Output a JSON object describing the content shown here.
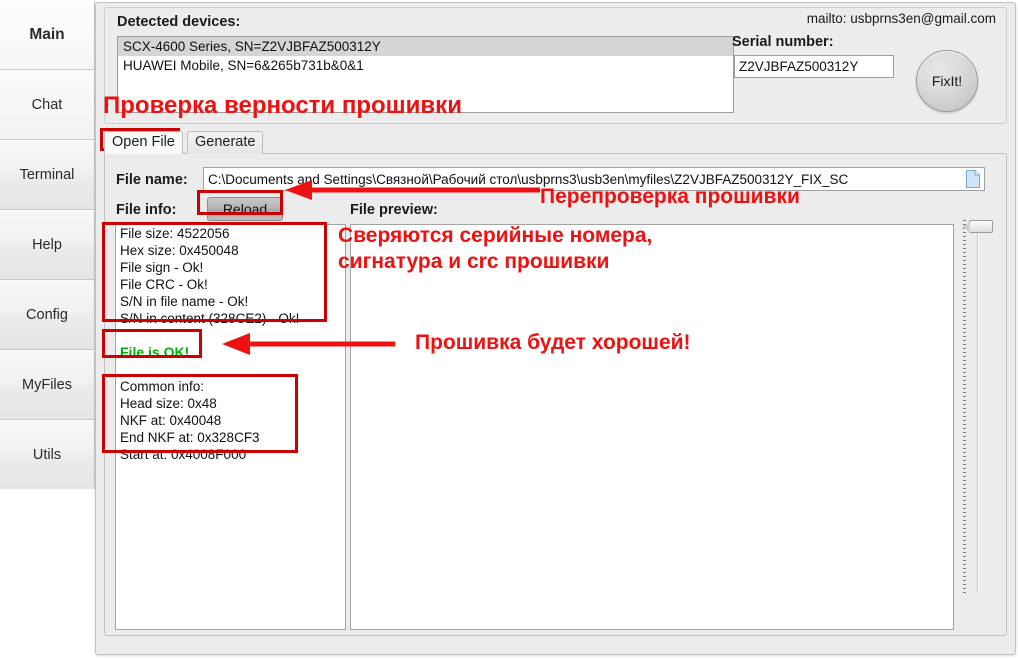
{
  "sidebar": {
    "items": [
      {
        "label": "Main",
        "selected": true
      },
      {
        "label": "Chat",
        "selected": false
      },
      {
        "label": "Terminal",
        "selected": false
      },
      {
        "label": "Help",
        "selected": false
      },
      {
        "label": "Config",
        "selected": false
      },
      {
        "label": "MyFiles",
        "selected": false
      },
      {
        "label": "Utils",
        "selected": false
      }
    ]
  },
  "device_group": {
    "detected_label": "Detected devices:",
    "devices": [
      {
        "text": "SCX-4600 Series, SN=Z2VJBFAZ500312Y",
        "selected": true
      },
      {
        "text": "HUAWEI Mobile, SN=6&265b731b&0&1",
        "selected": false
      }
    ],
    "mailto": "mailto: usbprns3en@gmail.com",
    "serial_label": "Serial number:",
    "serial_value": "Z2VJBFAZ500312Y",
    "fixit_label": "FixIt!"
  },
  "tabs": [
    {
      "label": "Open File",
      "selected": true
    },
    {
      "label": "Generate",
      "selected": false
    }
  ],
  "form": {
    "filename_label": "File name:",
    "filename_value": "C:\\Documents and Settings\\Связной\\Рабочий стол\\usbprns3\\usb3en\\myfiles\\Z2VJBFAZ500312Y_FIX_SC",
    "fileinfo_label": "File info:",
    "reload_label": "Reload",
    "preview_label": "File preview:"
  },
  "file_info": {
    "lines": [
      "File size: 4522056",
      "Hex size: 0x450048",
      "File sign - Ok!",
      "File CRC - Ok!",
      "S/N in file name - Ok!",
      "S/N in content (328CE2) - Ok!"
    ],
    "status": "File is OK!",
    "common": [
      "Common info:",
      "Head size: 0x48",
      "NKF at: 0x40048",
      "End NKF at: 0x328CF3",
      "Start at: 0x4008F000"
    ]
  },
  "annotations": {
    "title": "Проверка верности прошивки",
    "recheck": "Перепроверка прошивки",
    "compare_line1": "Сверяются серийные номера,",
    "compare_line2": "сигнатура и crc прошивки",
    "good": "Прошивка будет хорошей!",
    "color": "#ee1111",
    "box_color": "#cc0000"
  }
}
